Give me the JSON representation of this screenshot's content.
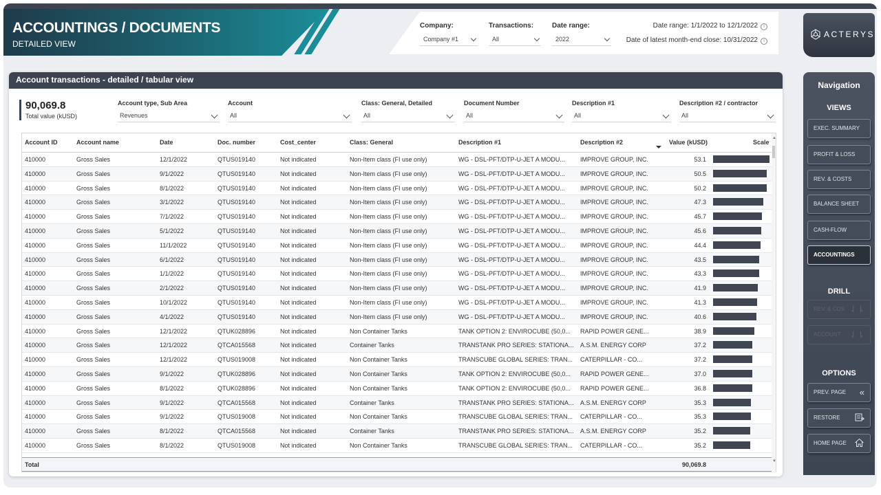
{
  "header": {
    "title": "ACCOUNTINGS / DOCUMENTS",
    "subtitle": "DETAILED VIEW"
  },
  "filters": {
    "company_label": "Company:",
    "company_value": "Company #1",
    "transactions_label": "Transactions:",
    "transactions_value": "All",
    "daterange_label": "Date range:",
    "daterange_value": "2022",
    "date_range_text": "Date range: 1/1/2022 to 12/1/2022",
    "latest_close_text": "Date of latest month-end close: 10/31/2022"
  },
  "logo": {
    "text": "ACTERYS"
  },
  "card": {
    "title": "Account transactions - detailed / tabular view",
    "kpi_value": "90,069.8",
    "kpi_label": "Total value (kUSD)",
    "slicers": [
      {
        "label": "Account type, Sub Area",
        "value": "Revenues"
      },
      {
        "label": "Account",
        "value": "All"
      },
      {
        "label": "Class: General, Detailed",
        "value": "All"
      },
      {
        "label": "Document Number",
        "value": "All"
      },
      {
        "label": "Description #1",
        "value": "All"
      },
      {
        "label": "Description #2 / contractor",
        "value": "All"
      }
    ]
  },
  "table": {
    "columns": [
      "Account ID",
      "Account name",
      "Date",
      "Doc. number",
      "Cost_center",
      "Class: General",
      "Description #1",
      "Description #2",
      "Value (kUSD)",
      "Scale"
    ],
    "rows": [
      [
        "410000",
        "Gross Sales",
        "12/1/2022",
        "QTUS019140",
        "Not indicated",
        "Non-Item class (FI use only)",
        "WG - DSL-PFT/DTP-U-JET A MODU...",
        "IMPROVE GROUP, INC.",
        "53.1"
      ],
      [
        "410000",
        "Gross Sales",
        "9/1/2022",
        "QTUS019140",
        "Not indicated",
        "Non-Item class (FI use only)",
        "WG - DSL-PFT/DTP-U-JET A MODU...",
        "IMPROVE GROUP, INC.",
        "50.5"
      ],
      [
        "410000",
        "Gross Sales",
        "8/1/2022",
        "QTUS019140",
        "Not indicated",
        "Non-Item class (FI use only)",
        "WG - DSL-PFT/DTP-U-JET A MODU...",
        "IMPROVE GROUP, INC.",
        "50.2"
      ],
      [
        "410000",
        "Gross Sales",
        "3/1/2022",
        "QTUS019140",
        "Not indicated",
        "Non-Item class (FI use only)",
        "WG - DSL-PFT/DTP-U-JET A MODU...",
        "IMPROVE GROUP, INC.",
        "47.3"
      ],
      [
        "410000",
        "Gross Sales",
        "7/1/2022",
        "QTUS019140",
        "Not indicated",
        "Non-Item class (FI use only)",
        "WG - DSL-PFT/DTP-U-JET A MODU...",
        "IMPROVE GROUP, INC.",
        "45.7"
      ],
      [
        "410000",
        "Gross Sales",
        "5/1/2022",
        "QTUS019140",
        "Not indicated",
        "Non-Item class (FI use only)",
        "WG - DSL-PFT/DTP-U-JET A MODU...",
        "IMPROVE GROUP, INC.",
        "45.6"
      ],
      [
        "410000",
        "Gross Sales",
        "11/1/2022",
        "QTUS019140",
        "Not indicated",
        "Non-Item class (FI use only)",
        "WG - DSL-PFT/DTP-U-JET A MODU...",
        "IMPROVE GROUP, INC.",
        "44.4"
      ],
      [
        "410000",
        "Gross Sales",
        "6/1/2022",
        "QTUS019140",
        "Not indicated",
        "Non-Item class (FI use only)",
        "WG - DSL-PFT/DTP-U-JET A MODU...",
        "IMPROVE GROUP, INC.",
        "43.5"
      ],
      [
        "410000",
        "Gross Sales",
        "1/1/2022",
        "QTUS019140",
        "Not indicated",
        "Non-Item class (FI use only)",
        "WG - DSL-PFT/DTP-U-JET A MODU...",
        "IMPROVE GROUP, INC.",
        "43.3"
      ],
      [
        "410000",
        "Gross Sales",
        "2/1/2022",
        "QTUS019140",
        "Not indicated",
        "Non-Item class (FI use only)",
        "WG - DSL-PFT/DTP-U-JET A MODU...",
        "IMPROVE GROUP, INC.",
        "41.9"
      ],
      [
        "410000",
        "Gross Sales",
        "10/1/2022",
        "QTUS019140",
        "Not indicated",
        "Non-Item class (FI use only)",
        "WG - DSL-PFT/DTP-U-JET A MODU...",
        "IMPROVE GROUP, INC.",
        "41.3"
      ],
      [
        "410000",
        "Gross Sales",
        "4/1/2022",
        "QTUS019140",
        "Not indicated",
        "Non-Item class (FI use only)",
        "WG - DSL-PFT/DTP-U-JET A MODU...",
        "IMPROVE GROUP, INC.",
        "40.6"
      ],
      [
        "410000",
        "Gross Sales",
        "12/1/2022",
        "QTUK028896",
        "Not indicated",
        "Non Container Tanks",
        "TANK OPTION 2:  ENVIROCUBE (50,0...",
        "RAPID POWER GENE...",
        "38.9"
      ],
      [
        "410000",
        "Gross Sales",
        "12/1/2022",
        "QTCA015568",
        "Not indicated",
        "Container Tanks",
        "TRANSTANK PRO SERIES: STATIONA...",
        "A.S.M. ENERGY CORP",
        "37.2"
      ],
      [
        "410000",
        "Gross Sales",
        "12/1/2022",
        "QTUS019008",
        "Not indicated",
        "Non Container Tanks",
        "TRANSCUBE GLOBAL SERIES: TRAN...",
        "CATERPILLAR - CO...",
        "37.2"
      ],
      [
        "410000",
        "Gross Sales",
        "9/1/2022",
        "QTUK028896",
        "Not indicated",
        "Non Container Tanks",
        "TANK OPTION 2:  ENVIROCUBE (50,0...",
        "RAPID POWER GENE...",
        "37.0"
      ],
      [
        "410000",
        "Gross Sales",
        "8/1/2022",
        "QTUK028896",
        "Not indicated",
        "Non Container Tanks",
        "TANK OPTION 2:  ENVIROCUBE (50,0...",
        "RAPID POWER GENE...",
        "36.8"
      ],
      [
        "410000",
        "Gross Sales",
        "9/1/2022",
        "QTCA015568",
        "Not indicated",
        "Container Tanks",
        "TRANSTANK PRO SERIES: STATIONA...",
        "A.S.M. ENERGY CORP",
        "35.3"
      ],
      [
        "410000",
        "Gross Sales",
        "9/1/2022",
        "QTUS019008",
        "Not indicated",
        "Non Container Tanks",
        "TRANSCUBE GLOBAL SERIES: TRAN...",
        "CATERPILLAR - CO...",
        "35.3"
      ],
      [
        "410000",
        "Gross Sales",
        "8/1/2022",
        "QTCA015568",
        "Not indicated",
        "Container Tanks",
        "TRANSTANK PRO SERIES: STATIONA...",
        "A.S.M. ENERGY CORP",
        "35.2"
      ],
      [
        "410000",
        "Gross Sales",
        "8/1/2022",
        "QTUS019008",
        "Not indicated",
        "Non Container Tanks",
        "TRANSCUBE GLOBAL SERIES: TRAN...",
        "CATERPILLAR - CO...",
        "35.2"
      ]
    ],
    "total_label": "Total",
    "total_value": "90,069.8"
  },
  "nav": {
    "title": "Navigation",
    "views_label": "VIEWS",
    "views": [
      "EXEC. SUMMARY",
      "PROFIT & LOSS",
      "REV. & COSTS",
      "BALANCE SHEET",
      "CASH-FLOW",
      "ACCOUNTINGS"
    ],
    "active_view": "ACCOUNTINGS",
    "drill_label": "DRILL",
    "drill": [
      "REV. & COS",
      "ACCOUNT"
    ],
    "options_label": "OPTIONS",
    "options": [
      {
        "label": "PREV. PAGE",
        "icon": "double-chevron-left-icon"
      },
      {
        "label": "RESTORE",
        "icon": "restore-icon"
      },
      {
        "label": "HOME PAGE",
        "icon": "home-icon"
      }
    ]
  },
  "colors": {
    "banner_dark": "#1f3b4a",
    "banner_teal": "#1b8d98",
    "header_dark": "#3d4451",
    "nav_bg": "#4b5361",
    "scale_bar": "#3f4652"
  }
}
